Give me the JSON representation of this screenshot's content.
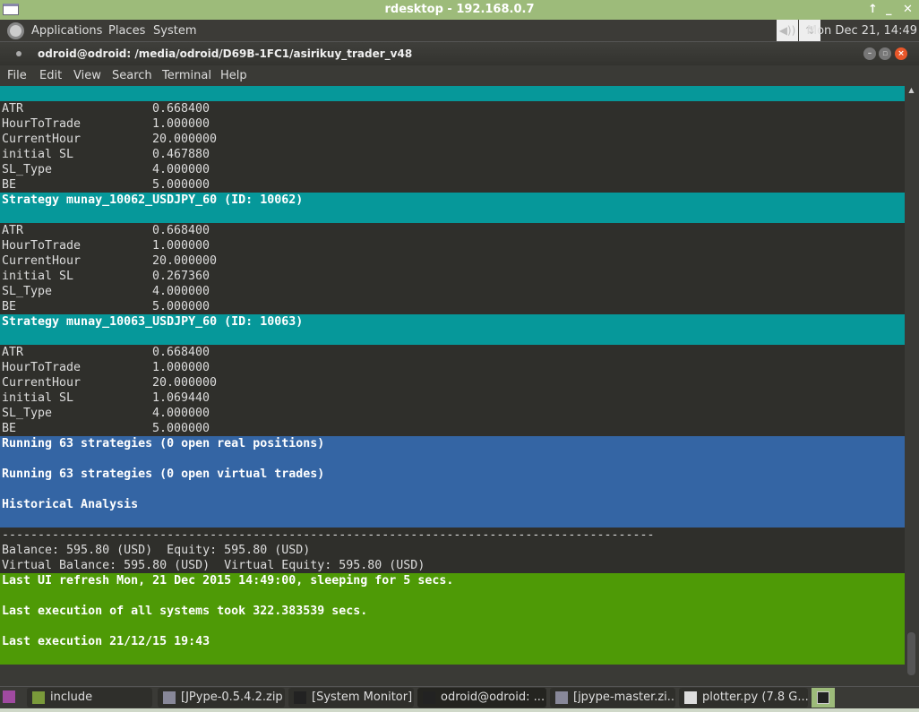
{
  "window": {
    "title": "rdesktop - 192.168.0.7",
    "controls": [
      "↑",
      "_",
      "✕"
    ]
  },
  "panel": {
    "menus": [
      "Applications",
      "Places",
      "System"
    ],
    "clock": "Mon Dec 21, 14:49",
    "tray_icons": [
      "volume-icon",
      "network-icon"
    ]
  },
  "terminal": {
    "title": "odroid@odroid: /media/odroid/D69B-1FC1/asirikuy_trader_v48",
    "menu": [
      "File",
      "Edit",
      "View",
      "Search",
      "Terminal",
      "Help"
    ],
    "lines": [
      {
        "style": "teal",
        "text": ""
      },
      {
        "key": "ATR",
        "val": "0.668400"
      },
      {
        "key": "HourToTrade",
        "val": "1.000000"
      },
      {
        "key": "CurrentHour",
        "val": "20.000000"
      },
      {
        "key": "initial SL",
        "val": "0.467880"
      },
      {
        "key": "SL_Type",
        "val": "4.000000"
      },
      {
        "key": "BE",
        "val": "5.000000"
      },
      {
        "style": "teal",
        "text": "Strategy munay_10062_USDJPY_60 (ID: 10062)"
      },
      {
        "style": "teal",
        "text": ""
      },
      {
        "key": "ATR",
        "val": "0.668400"
      },
      {
        "key": "HourToTrade",
        "val": "1.000000"
      },
      {
        "key": "CurrentHour",
        "val": "20.000000"
      },
      {
        "key": "initial SL",
        "val": "0.267360"
      },
      {
        "key": "SL_Type",
        "val": "4.000000"
      },
      {
        "key": "BE",
        "val": "5.000000"
      },
      {
        "style": "teal",
        "text": "Strategy munay_10063_USDJPY_60 (ID: 10063)"
      },
      {
        "style": "teal",
        "text": ""
      },
      {
        "key": "ATR",
        "val": "0.668400"
      },
      {
        "key": "HourToTrade",
        "val": "1.000000"
      },
      {
        "key": "CurrentHour",
        "val": "20.000000"
      },
      {
        "key": "initial SL",
        "val": "1.069440"
      },
      {
        "key": "SL_Type",
        "val": "4.000000"
      },
      {
        "key": "BE",
        "val": "5.000000"
      },
      {
        "style": "blue",
        "text": "Running 63 strategies (0 open real positions)"
      },
      {
        "style": "blue",
        "text": ""
      },
      {
        "style": "blue",
        "text": "Running 63 strategies (0 open virtual trades)"
      },
      {
        "style": "blue",
        "text": ""
      },
      {
        "style": "blue",
        "text": "Historical Analysis"
      },
      {
        "style": "blue",
        "text": ""
      },
      {
        "text": "-------------------------------------------------------------------------------------------"
      },
      {
        "text": "Balance: 595.80 (USD)  Equity: 595.80 (USD)"
      },
      {
        "text": "Virtual Balance: 595.80 (USD)  Virtual Equity: 595.80 (USD)"
      },
      {
        "style": "green",
        "text": "Last UI refresh Mon, 21 Dec 2015 14:49:00, sleeping for 5 secs."
      },
      {
        "style": "green",
        "text": ""
      },
      {
        "style": "green",
        "text": "Last execution of all systems took 322.383539 secs."
      },
      {
        "style": "green",
        "text": ""
      },
      {
        "style": "green",
        "text": "Last execution 21/12/15 19:43"
      },
      {
        "style": "green",
        "text": ""
      }
    ]
  },
  "taskbar": {
    "items": [
      {
        "label": "include",
        "icon": "folder-icon"
      },
      {
        "label": "[JPype-0.5.4.2.zip ]",
        "icon": "archive-icon"
      },
      {
        "label": "[System Monitor]",
        "icon": "system-monitor-icon"
      },
      {
        "label": "odroid@odroid: ...",
        "icon": "terminal-icon"
      },
      {
        "label": "[jpype-master.zi...",
        "icon": "archive-icon"
      },
      {
        "label": "plotter.py (7.8 G...",
        "icon": "text-editor-icon"
      }
    ]
  }
}
